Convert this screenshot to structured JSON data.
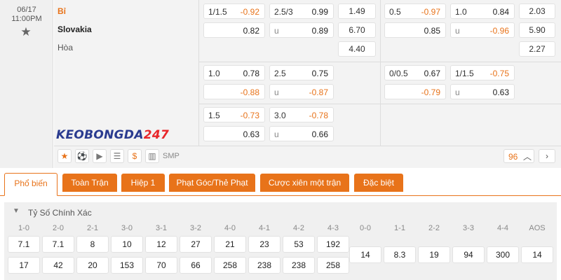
{
  "match": {
    "date": "06/17",
    "time": "11:00PM",
    "home": "Bỉ",
    "away": "Slovakia",
    "draw": "Hòa",
    "logo_a": "KEOBONGDA",
    "logo_b": "247"
  },
  "odds": {
    "ft": {
      "r1": {
        "hdp_home_h": "1/1.5",
        "hdp_home_v": "-0.92",
        "hdp_away_v": "0.82",
        "ou_over_h": "2.5/3",
        "ou_over_v": "0.99",
        "ou_under_h": "u",
        "ou_under_v": "0.89",
        "x12_home": "1.49",
        "x12_away": "6.70",
        "x12_draw": "4.40"
      },
      "r2": {
        "hdp_home_h": "1.0",
        "hdp_home_v": "0.78",
        "hdp_away_v": "-0.88",
        "ou_over_h": "2.5",
        "ou_over_v": "0.75",
        "ou_under_h": "u",
        "ou_under_v": "-0.87"
      },
      "r3": {
        "hdp_home_h": "1.5",
        "hdp_home_v": "-0.73",
        "hdp_away_v": "0.63",
        "ou_over_h": "3.0",
        "ou_over_v": "-0.78",
        "ou_under_h": "u",
        "ou_under_v": "0.66"
      }
    },
    "h1": {
      "r1": {
        "hdp_home_h": "0.5",
        "hdp_home_v": "-0.97",
        "hdp_away_v": "0.85",
        "ou_over_h": "1.0",
        "ou_over_v": "0.84",
        "ou_under_h": "u",
        "ou_under_v": "-0.96",
        "x12_home": "2.03",
        "x12_away": "5.90",
        "x12_draw": "2.27"
      },
      "r2": {
        "hdp_home_h": "0/0.5",
        "hdp_home_v": "0.67",
        "hdp_away_v": "-0.79",
        "ou_over_h": "1/1.5",
        "ou_over_v": "-0.75",
        "ou_under_h": "u",
        "ou_under_v": "0.63"
      }
    }
  },
  "toolbar": {
    "smp": "SMP",
    "more_count": "96"
  },
  "tabs": [
    "Phổ biến",
    "Toàn Trận",
    "Hiệp 1",
    "Phạt Góc/Thẻ Phạt",
    "Cược xiên một trận",
    "Đặc biệt"
  ],
  "section": {
    "title": "Tỷ Số Chính Xác"
  },
  "correct_score": {
    "home": [
      {
        "label": "1-0",
        "odd": "7.1"
      },
      {
        "label": "2-0",
        "odd": "7.1"
      },
      {
        "label": "2-1",
        "odd": "8"
      },
      {
        "label": "3-0",
        "odd": "10"
      },
      {
        "label": "3-1",
        "odd": "12"
      },
      {
        "label": "3-2",
        "odd": "27"
      },
      {
        "label": "4-0",
        "odd": "21"
      },
      {
        "label": "4-1",
        "odd": "23"
      },
      {
        "label": "4-2",
        "odd": "53"
      },
      {
        "label": "4-3",
        "odd": "192"
      }
    ],
    "away": [
      "17",
      "42",
      "20",
      "153",
      "70",
      "66",
      "258",
      "238",
      "238",
      "258"
    ],
    "draws": [
      {
        "label": "0-0",
        "odd": "14"
      },
      {
        "label": "1-1",
        "odd": "8.3"
      },
      {
        "label": "2-2",
        "odd": "19"
      },
      {
        "label": "3-3",
        "odd": "94"
      },
      {
        "label": "4-4",
        "odd": "300"
      },
      {
        "label": "AOS",
        "odd": "14"
      }
    ]
  },
  "colors": {
    "accent": "#e8731a",
    "panel_bg": "#f3f3f3",
    "border": "#dddddd"
  }
}
